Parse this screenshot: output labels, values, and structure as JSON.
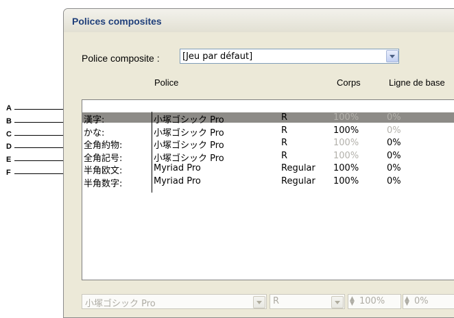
{
  "dialog": {
    "title": "Polices composites"
  },
  "composite_font": {
    "label": "Police composite :",
    "value": "[Jeu par défaut]"
  },
  "columns": {
    "font": "Police",
    "size": "Corps",
    "baseline": "Ligne de base"
  },
  "callouts": [
    "A",
    "B",
    "C",
    "D",
    "E",
    "F"
  ],
  "rows": [
    {
      "category": "漢字:",
      "font": "小塚ゴシック Pro",
      "style": "R",
      "size": "100%",
      "baseline": "0%"
    },
    {
      "category": "かな:",
      "font": "小塚ゴシック Pro",
      "style": "R",
      "size": "100%",
      "baseline": "0%"
    },
    {
      "category": "全角約物:",
      "font": "小塚ゴシック Pro",
      "style": "R",
      "size": "100%",
      "baseline": "0%"
    },
    {
      "category": "全角記号:",
      "font": "小塚ゴシック Pro",
      "style": "R",
      "size": "100%",
      "baseline": "0%"
    },
    {
      "category": "半角欧文:",
      "font": "Myriad Pro",
      "style": "Regular",
      "size": "100%",
      "baseline": "0%"
    },
    {
      "category": "半角数字:",
      "font": "Myriad Pro",
      "style": "Regular",
      "size": "100%",
      "baseline": "0%"
    }
  ],
  "bottom_controls": {
    "font": "小塚ゴシック Pro",
    "style": "R",
    "size": "100%",
    "baseline": "0%"
  }
}
